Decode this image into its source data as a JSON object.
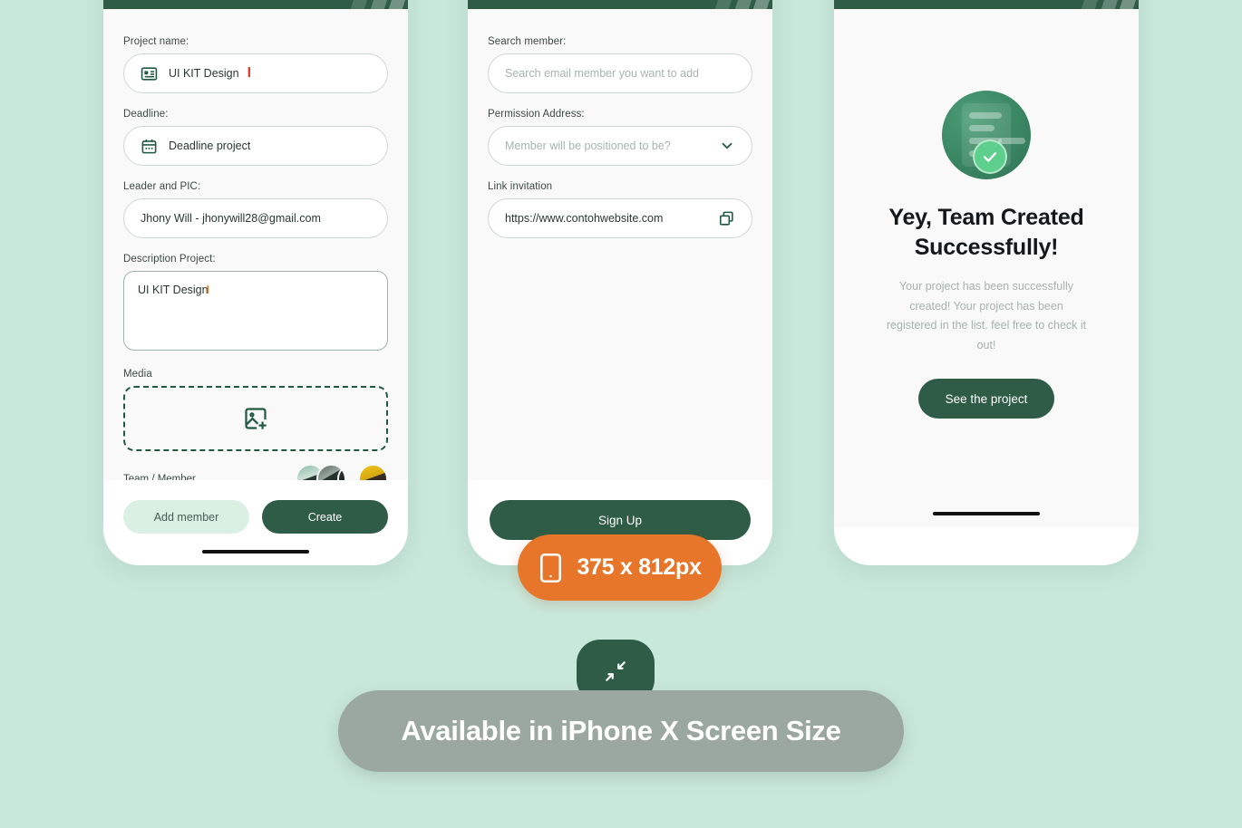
{
  "background_color": "#c9e8dc",
  "accent_colors": {
    "primary_green": "#2e5c47",
    "soft_green": "#d9f0e3",
    "orange": "#e8762a",
    "banner_gray": "#9aa8a1",
    "check_green": "#5fcf8d"
  },
  "phone_1": {
    "name": "create-project-screen",
    "fields": {
      "project_name": {
        "label": "Project name:",
        "value": "UI KIT Design",
        "cursor": "I",
        "icon": "id-card-icon"
      },
      "deadline": {
        "label": "Deadline:",
        "placeholder": "Deadline project",
        "icon": "calendar-icon"
      },
      "leader": {
        "label": "Leader and PIC:",
        "value": "Jhony Will - jhonywill28@gmail.com"
      },
      "description": {
        "label": "Description Project:",
        "value": "UI KIT Design",
        "cursor": "I"
      },
      "media": {
        "label": "Media",
        "icon": "add-image-icon"
      },
      "team": {
        "label": "Team / Member",
        "avatar_count": 4
      }
    },
    "buttons": {
      "add_member": "Add member",
      "create": "Create"
    }
  },
  "phone_2": {
    "name": "add-member-screen",
    "fields": {
      "search_member": {
        "label": "Search member:",
        "placeholder": "Search email member you want to add"
      },
      "permission": {
        "label": "Permission Address:",
        "placeholder": "Member will be positioned to be?",
        "icon": "chevron-down-icon"
      },
      "link_invitation": {
        "label": "Link invitation",
        "value": "https://www.contohwebsite.com",
        "icon": "copy-icon"
      }
    },
    "buttons": {
      "sign_up": "Sign Up"
    }
  },
  "phone_3": {
    "name": "team-created-success-screen",
    "icon": "document-check-icon",
    "title": "Yey, Team Created Successfully!",
    "description": "Your project has been successfully created! Your project has been registered in the list. feel free to check it out!",
    "buttons": {
      "see_project": "See the project"
    }
  },
  "size_badge": {
    "icon": "mobile-icon",
    "label": "375 x 812px"
  },
  "bottom_banner": {
    "chip_icon": "collapse-arrows-icon",
    "label": "Available in iPhone X Screen Size"
  }
}
